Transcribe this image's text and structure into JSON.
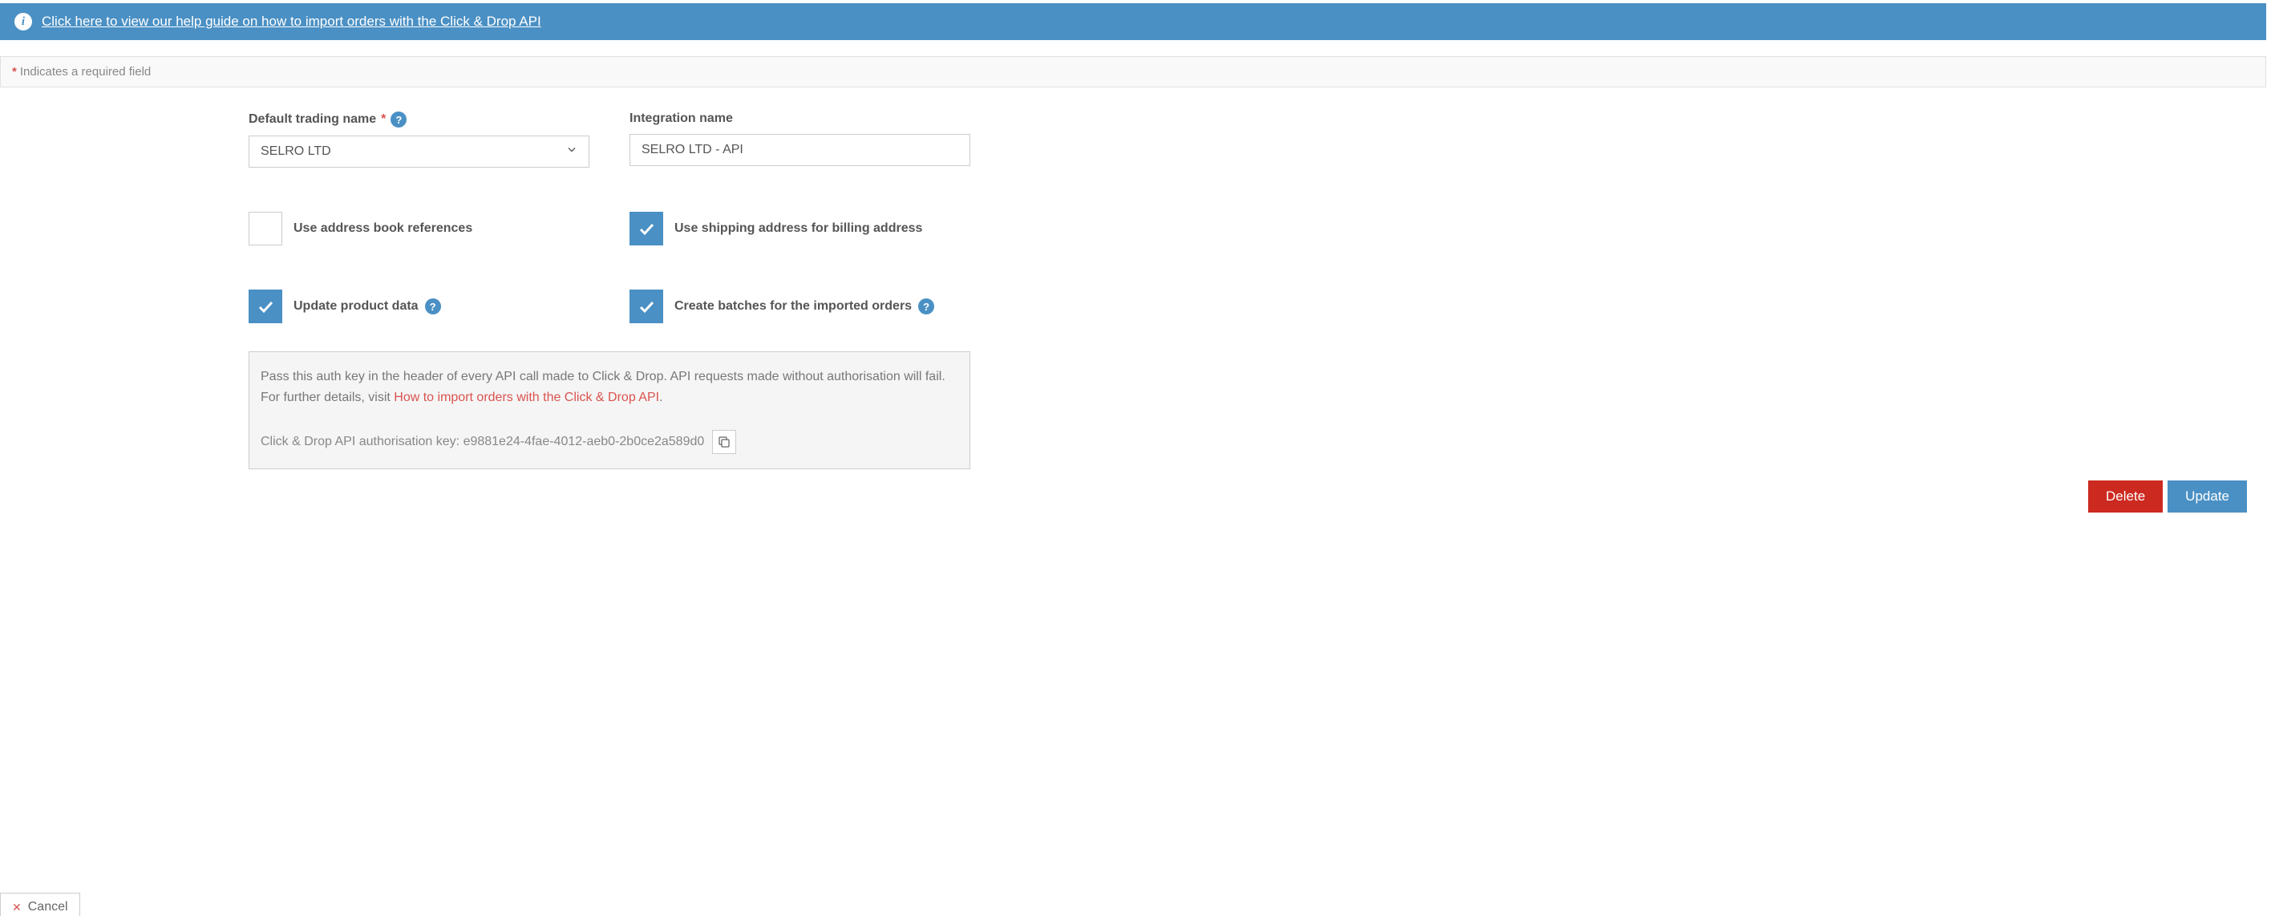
{
  "banner": {
    "link_text": "Click here to view our help guide on how to import orders with the Click & Drop API"
  },
  "required_note": "Indicates a required field",
  "fields": {
    "trading_name": {
      "label": "Default trading name",
      "value": "SELRO LTD"
    },
    "integration_name": {
      "label": "Integration name",
      "value": "SELRO LTD - API"
    }
  },
  "checkboxes": {
    "address_book": {
      "label": "Use address book references",
      "checked": false
    },
    "shipping_billing": {
      "label": "Use shipping address for billing address",
      "checked": true
    },
    "update_product": {
      "label": "Update product data",
      "checked": true
    },
    "create_batches": {
      "label": "Create batches for the imported orders",
      "checked": true
    }
  },
  "api_box": {
    "text_before_link": "Pass this auth key in the header of every API call made to Click & Drop. API requests made without authorisation will fail. For further details, visit ",
    "link_text": "How to import orders with the Click & Drop API",
    "period": ".",
    "key_label": "Click & Drop API authorisation key: ",
    "key_value": "e9881e24-4fae-4012-aeb0-2b0ce2a589d0"
  },
  "actions": {
    "delete": "Delete",
    "update": "Update",
    "cancel": "Cancel"
  }
}
